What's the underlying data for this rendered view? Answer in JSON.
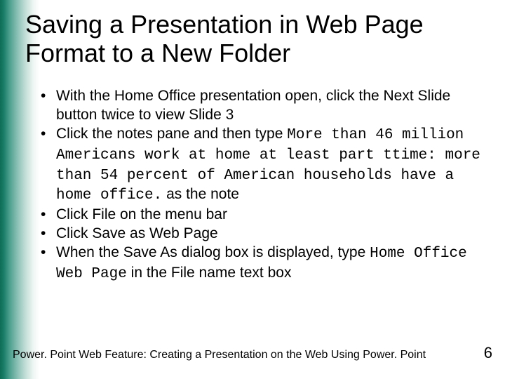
{
  "title": "Saving a Presentation in Web Page Format to a New Folder",
  "bullets": {
    "b0": "With the Home Office presentation open, click the Next Slide button twice to view Slide 3",
    "b1_pre": "Click the notes pane and then type ",
    "b1_mono": "More than 46 million Americans work at home at least part ttime: more than 54 percent of American households have a home office.",
    "b1_post": " as the note",
    "b2": "Click File on the menu bar",
    "b3": "Click Save as Web Page",
    "b4_pre": "When the Save As dialog box is displayed, type ",
    "b4_mono": "Home Office Web Page",
    "b4_post": " in the File name text box"
  },
  "footer": {
    "left": "Power. Point Web Feature: Creating a Presentation on the Web Using Power. Point",
    "page": "6"
  }
}
